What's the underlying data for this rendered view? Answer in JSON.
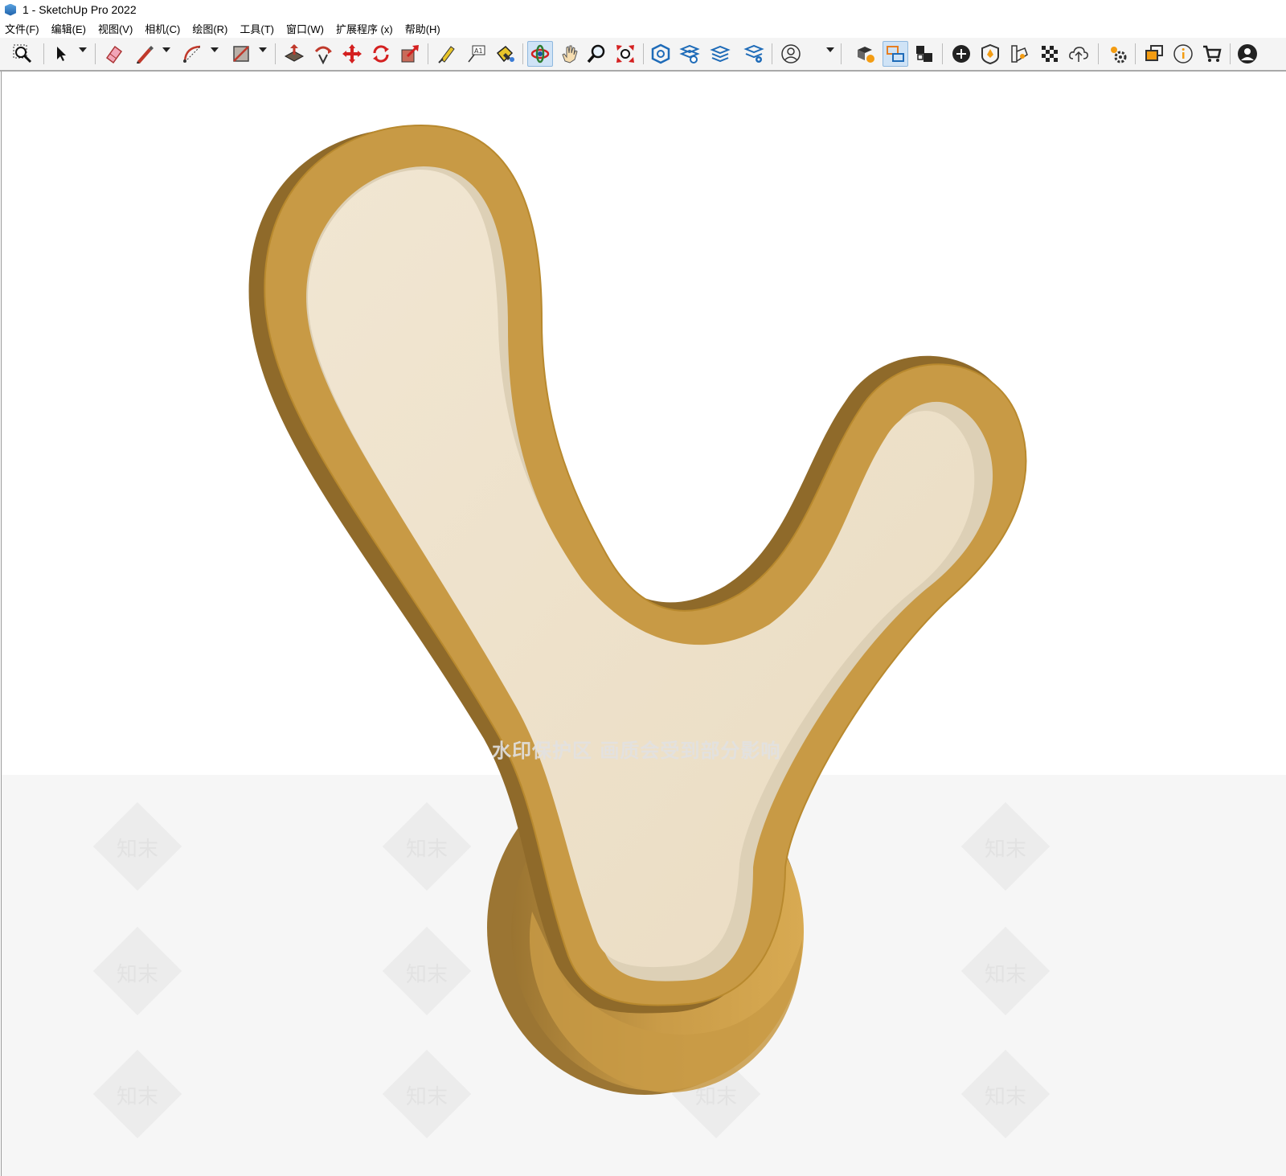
{
  "window": {
    "title": "1 - SketchUp Pro 2022"
  },
  "menubar": {
    "items": [
      "文件(F)",
      "编辑(E)",
      "视图(V)",
      "相机(C)",
      "绘图(R)",
      "工具(T)",
      "窗口(W)",
      "扩展程序 (x)",
      "帮助(H)"
    ]
  },
  "toolbar": {
    "icons": [
      "zoom-window-icon",
      "select-arrow-icon",
      "eraser-icon",
      "pencil-line-icon",
      "arc-icon",
      "rectangle-icon",
      "push-pull-icon",
      "follow-me-icon",
      "move-icon",
      "rotate-icon",
      "scale-icon",
      "tape-measure-icon",
      "text-label-icon",
      "paint-bucket-icon",
      "orbit-icon",
      "pan-hand-icon",
      "zoom-icon",
      "zoom-extents-icon",
      "3d-warehouse-icon",
      "extension-warehouse-icon",
      "layout-icon",
      "extension-manager-icon",
      "user-account-icon",
      "style-builder-icon",
      "outliner-icon",
      "scenes-icon",
      "add-location-icon",
      "section-plane-icon",
      "materials-icon",
      "checkerboard-icon",
      "cloud-icon",
      "settings-gears-icon",
      "components-icon",
      "info-icon",
      "cart-icon",
      "profile-icon"
    ],
    "active": [
      "orbit-icon",
      "outliner-icon"
    ]
  },
  "colors": {
    "accent_gold": "#c89a45",
    "gold_dark": "#8f6a2a",
    "inner_fill": "#f0e4cf",
    "toolbar_bg": "#f4f4f4",
    "active_btn": "#cfe3f6"
  },
  "watermark": {
    "notice": "水印保护区 画质会受到部分影响",
    "tile_text": "知末"
  }
}
